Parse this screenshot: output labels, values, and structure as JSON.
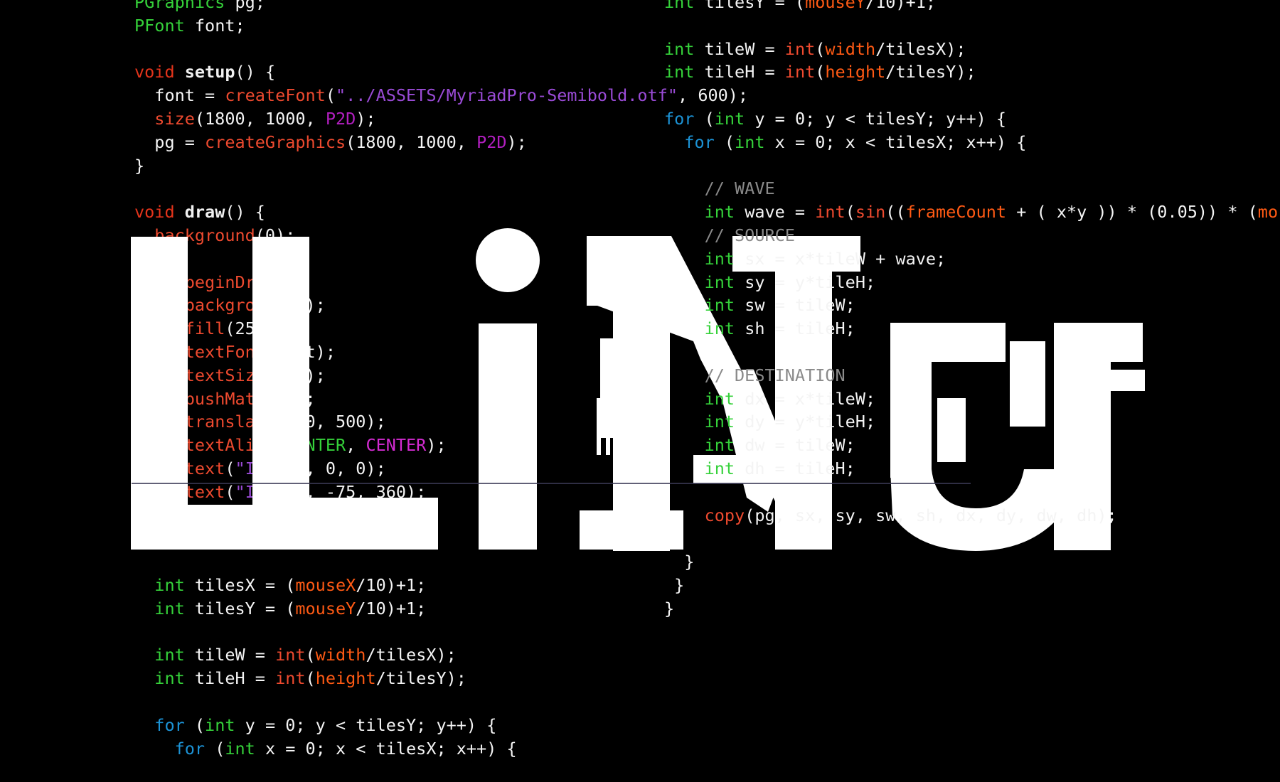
{
  "artwork": {
    "glyphs_text": "ILiNu",
    "color": "#ffffff",
    "background": "#000000"
  },
  "syntax_colors": {
    "type": "#35d13a",
    "keyword": "#e4341b",
    "function": "#ee4a2f",
    "string": "#9a4bd6",
    "constant": "#b21fc0",
    "variable": "#ff5a14",
    "flow": "#1c93d6",
    "comment": "#8a8a8a",
    "plain": "#f4f4f4"
  },
  "code_left": [
    [
      [
        "t",
        "PGraphics"
      ],
      [
        "p",
        " pg;"
      ]
    ],
    [
      [
        "t",
        "PFont"
      ],
      [
        "p",
        " font;"
      ]
    ],
    [],
    [
      [
        "k",
        "void"
      ],
      [
        "p",
        " "
      ],
      [
        "b",
        "setup"
      ],
      [
        "p",
        "() {"
      ]
    ],
    [
      [
        "p",
        "  font = "
      ],
      [
        "f",
        "createFont"
      ],
      [
        "p",
        "("
      ],
      [
        "s",
        "\"../ASSETS/MyriadPro-Semibold.otf\""
      ],
      [
        "p",
        ", 600);"
      ]
    ],
    [
      [
        "p",
        "  "
      ],
      [
        "f",
        "size"
      ],
      [
        "p",
        "(1800, 1000, "
      ],
      [
        "c",
        "P2D"
      ],
      [
        "p",
        ");"
      ]
    ],
    [
      [
        "p",
        "  pg = "
      ],
      [
        "f",
        "createGraphics"
      ],
      [
        "p",
        "(1800, 1000, "
      ],
      [
        "c",
        "P2D"
      ],
      [
        "p",
        ");"
      ]
    ],
    [
      [
        "p",
        "}"
      ]
    ],
    [],
    [
      [
        "k",
        "void"
      ],
      [
        "p",
        " "
      ],
      [
        "b",
        "draw"
      ],
      [
        "p",
        "() {"
      ]
    ],
    [
      [
        "p",
        "  "
      ],
      [
        "f",
        "background"
      ],
      [
        "p",
        "(0);"
      ]
    ],
    [],
    [
      [
        "p",
        "  pg."
      ],
      [
        "f",
        "beginDraw"
      ],
      [
        "p",
        "();"
      ]
    ],
    [
      [
        "p",
        "  pg."
      ],
      [
        "f",
        "background"
      ],
      [
        "p",
        "(0);"
      ]
    ],
    [
      [
        "p",
        "  pg."
      ],
      [
        "f",
        "fill"
      ],
      [
        "p",
        "(255);"
      ]
    ],
    [
      [
        "p",
        "  pg."
      ],
      [
        "f",
        "textFont"
      ],
      [
        "p",
        "(font);"
      ]
    ],
    [
      [
        "p",
        "  pg."
      ],
      [
        "f",
        "textSize"
      ],
      [
        "p",
        "(500);"
      ]
    ],
    [
      [
        "p",
        "  pg."
      ],
      [
        "f",
        "pushMatrix"
      ],
      [
        "p",
        "();"
      ]
    ],
    [
      [
        "p",
        "  pg."
      ],
      [
        "f",
        "translate"
      ],
      [
        "p",
        "(900, 500);"
      ]
    ],
    [
      [
        "p",
        "  pg."
      ],
      [
        "f",
        "textAlign"
      ],
      [
        "p",
        "("
      ],
      [
        "t",
        "CENTER"
      ],
      [
        "p",
        ", "
      ],
      [
        "cc",
        "CENTER"
      ],
      [
        "p",
        ");"
      ]
    ],
    [
      [
        "p",
        "  pg."
      ],
      [
        "f",
        "text"
      ],
      [
        "p",
        "("
      ],
      [
        "s",
        "\"ILiDi\""
      ],
      [
        "p",
        ", 0, 0);"
      ]
    ],
    [
      [
        "p",
        "  pg."
      ],
      [
        "f",
        "text"
      ],
      [
        "p",
        "("
      ],
      [
        "s",
        "\"ILiNu\""
      ],
      [
        "p",
        ", -75, 360);"
      ]
    ],
    [
      [
        "p",
        "  pg."
      ],
      [
        "f",
        "popMatrix"
      ],
      [
        "p",
        "();"
      ]
    ],
    [
      [
        "p",
        "  pg."
      ],
      [
        "f",
        "endDraw"
      ],
      [
        "p",
        "();"
      ]
    ],
    [],
    [
      [
        "p",
        "  "
      ],
      [
        "t",
        "int"
      ],
      [
        "p",
        " tilesX = ("
      ],
      [
        "v",
        "mouseX"
      ],
      [
        "p",
        "/10)+1;"
      ]
    ],
    [
      [
        "p",
        "  "
      ],
      [
        "t",
        "int"
      ],
      [
        "p",
        " tilesY = ("
      ],
      [
        "v",
        "mouseY"
      ],
      [
        "p",
        "/10)+1;"
      ]
    ],
    [],
    [
      [
        "p",
        "  "
      ],
      [
        "t",
        "int"
      ],
      [
        "p",
        " tileW = "
      ],
      [
        "f",
        "int"
      ],
      [
        "p",
        "("
      ],
      [
        "v",
        "width"
      ],
      [
        "p",
        "/tilesX);"
      ]
    ],
    [
      [
        "p",
        "  "
      ],
      [
        "t",
        "int"
      ],
      [
        "p",
        " tileH = "
      ],
      [
        "f",
        "int"
      ],
      [
        "p",
        "("
      ],
      [
        "v",
        "height"
      ],
      [
        "p",
        "/tilesY);"
      ]
    ],
    [],
    [
      [
        "p",
        "  "
      ],
      [
        "sf",
        "for"
      ],
      [
        "p",
        " ("
      ],
      [
        "t",
        "int"
      ],
      [
        "p",
        " y = 0; y < tilesY; y++) {"
      ]
    ],
    [
      [
        "p",
        "    "
      ],
      [
        "sf",
        "for"
      ],
      [
        "p",
        " ("
      ],
      [
        "t",
        "int"
      ],
      [
        "p",
        " x = 0; x < tilesX; x++) {"
      ]
    ]
  ],
  "code_right": [
    [
      [
        "t",
        "int"
      ],
      [
        "p",
        " tilesY = ("
      ],
      [
        "v",
        "mouseY"
      ],
      [
        "p",
        "/10)+1;"
      ]
    ],
    [],
    [
      [
        "t",
        "int"
      ],
      [
        "p",
        " tileW = "
      ],
      [
        "f",
        "int"
      ],
      [
        "p",
        "("
      ],
      [
        "v",
        "width"
      ],
      [
        "p",
        "/tilesX);"
      ]
    ],
    [
      [
        "t",
        "int"
      ],
      [
        "p",
        " tileH = "
      ],
      [
        "f",
        "int"
      ],
      [
        "p",
        "("
      ],
      [
        "v",
        "height"
      ],
      [
        "p",
        "/tilesY);"
      ]
    ],
    [],
    [
      [
        "sf",
        "for"
      ],
      [
        "p",
        " ("
      ],
      [
        "t",
        "int"
      ],
      [
        "p",
        " y = 0; y < tilesY; y++) {"
      ]
    ],
    [
      [
        "p",
        "  "
      ],
      [
        "sf",
        "for"
      ],
      [
        "p",
        " ("
      ],
      [
        "t",
        "int"
      ],
      [
        "p",
        " x = 0; x < tilesX; x++) {"
      ]
    ],
    [],
    [
      [
        "p",
        "    "
      ],
      [
        "m",
        "// WAVE"
      ]
    ],
    [
      [
        "p",
        "    "
      ],
      [
        "t",
        "int"
      ],
      [
        "p",
        " wave = "
      ],
      [
        "f",
        "int"
      ],
      [
        "p",
        "("
      ],
      [
        "f",
        "sin"
      ],
      [
        "p",
        "(("
      ],
      [
        "v",
        "frameCount"
      ],
      [
        "p",
        " + ( x*y )) * (0.05)) * ("
      ],
      [
        "v",
        "mo"
      ]
    ],
    [
      [
        "p",
        "    "
      ],
      [
        "m",
        "// SOURCE"
      ]
    ],
    [
      [
        "p",
        "    "
      ],
      [
        "t",
        "int"
      ],
      [
        "p",
        " sx = x*tileW + wave;"
      ]
    ],
    [
      [
        "p",
        "    "
      ],
      [
        "t",
        "int"
      ],
      [
        "p",
        " sy = y*tileH;"
      ]
    ],
    [
      [
        "p",
        "    "
      ],
      [
        "t",
        "int"
      ],
      [
        "p",
        " sw = tileW;"
      ]
    ],
    [
      [
        "p",
        "    "
      ],
      [
        "t",
        "int"
      ],
      [
        "p",
        " sh = tileH;"
      ]
    ],
    [],
    [
      [
        "p",
        "    "
      ],
      [
        "m",
        "// DESTINATION"
      ]
    ],
    [
      [
        "p",
        "    "
      ],
      [
        "t",
        "int"
      ],
      [
        "p",
        " dx = x*tileW;"
      ]
    ],
    [
      [
        "p",
        "    "
      ],
      [
        "t",
        "int"
      ],
      [
        "p",
        " dy = y*tileH;"
      ]
    ],
    [
      [
        "p",
        "    "
      ],
      [
        "t",
        "int"
      ],
      [
        "p",
        " dw = tileW;"
      ]
    ],
    [
      [
        "p",
        "    "
      ],
      [
        "t",
        "int"
      ],
      [
        "p",
        " dh = tileH;"
      ]
    ],
    [],
    [
      [
        "p",
        "    "
      ],
      [
        "f",
        "copy"
      ],
      [
        "p",
        "(pg, sx, sy, sw, sh, dx, dy, dw, dh);"
      ]
    ],
    [],
    [
      [
        "p",
        "  }"
      ]
    ],
    [
      [
        "p",
        " }"
      ]
    ],
    [
      [
        "p",
        "}"
      ]
    ]
  ]
}
